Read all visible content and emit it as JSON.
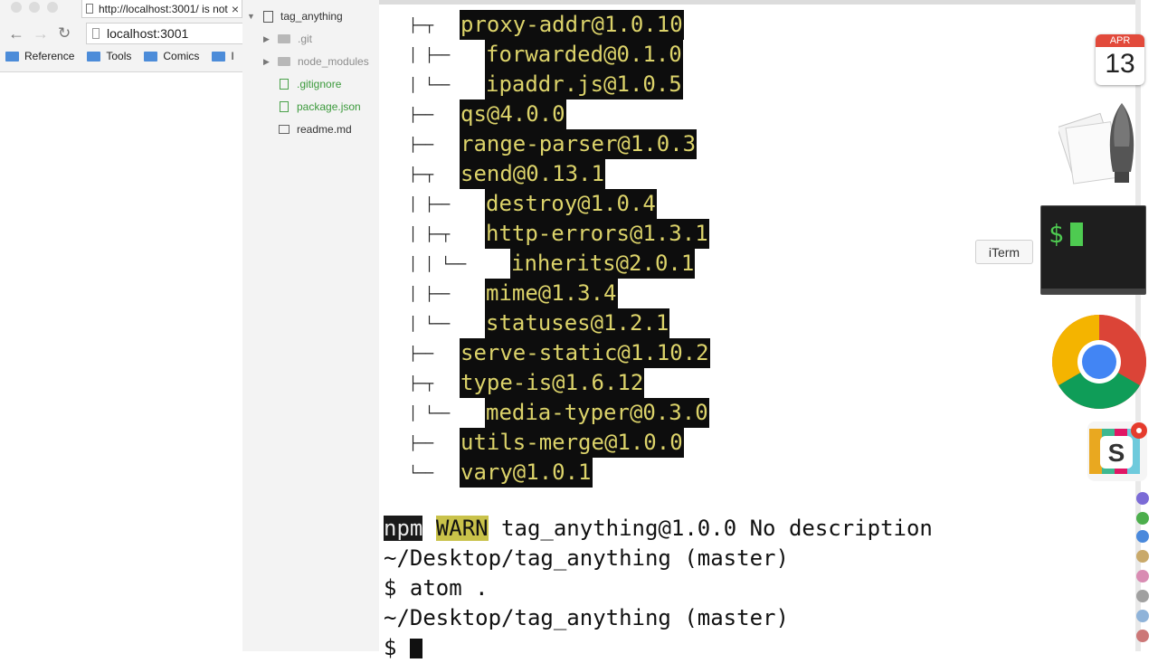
{
  "browser": {
    "tab_title": "http://localhost:3001/ is not",
    "address": "localhost:3001",
    "bookmarks": [
      "Reference",
      "Tools",
      "Comics",
      "I"
    ]
  },
  "treeview": {
    "root": "tag_anything",
    "items": [
      {
        "label": ".git",
        "kind": "folder"
      },
      {
        "label": "node_modules",
        "kind": "folder"
      },
      {
        "label": ".gitignore",
        "kind": "file-new"
      },
      {
        "label": "package.json",
        "kind": "file-new"
      },
      {
        "label": "readme.md",
        "kind": "file"
      }
    ]
  },
  "terminal": {
    "tree_lines": [
      {
        "prefix": "├─┬",
        "pkg": "proxy-addr@1.0.10"
      },
      {
        "prefix": "│ ├──",
        "pkg": "forwarded@0.1.0"
      },
      {
        "prefix": "│ └──",
        "pkg": "ipaddr.js@1.0.5"
      },
      {
        "prefix": "├──",
        "pkg": "qs@4.0.0"
      },
      {
        "prefix": "├──",
        "pkg": "range-parser@1.0.3"
      },
      {
        "prefix": "├─┬",
        "pkg": "send@0.13.1"
      },
      {
        "prefix": "│ ├──",
        "pkg": "destroy@1.0.4"
      },
      {
        "prefix": "│ ├─┬",
        "pkg": "http-errors@1.3.1"
      },
      {
        "prefix": "│ │ └──",
        "pkg": "inherits@2.0.1"
      },
      {
        "prefix": "│ ├──",
        "pkg": "mime@1.3.4"
      },
      {
        "prefix": "│ └──",
        "pkg": "statuses@1.2.1"
      },
      {
        "prefix": "├──",
        "pkg": "serve-static@1.10.2"
      },
      {
        "prefix": "├─┬",
        "pkg": "type-is@1.6.12"
      },
      {
        "prefix": "│ └──",
        "pkg": "media-typer@0.3.0"
      },
      {
        "prefix": "├──",
        "pkg": "utils-merge@1.0.0"
      },
      {
        "prefix": "└──",
        "pkg": "vary@1.0.1"
      }
    ],
    "npm_label": "npm",
    "warn_label": "WARN",
    "warn_text": " tag_anything@1.0.0 No description",
    "cwd1": "~/Desktop/tag_anything (master)",
    "command": "$ atom .",
    "cwd2": "~/Desktop/tag_anything (master)",
    "prompt": "$ "
  },
  "dock": {
    "calendar_month": "APR",
    "calendar_day": "13",
    "iterm_tooltip": "iTerm",
    "iterm_prompt": "$",
    "slack_letter": "S"
  }
}
